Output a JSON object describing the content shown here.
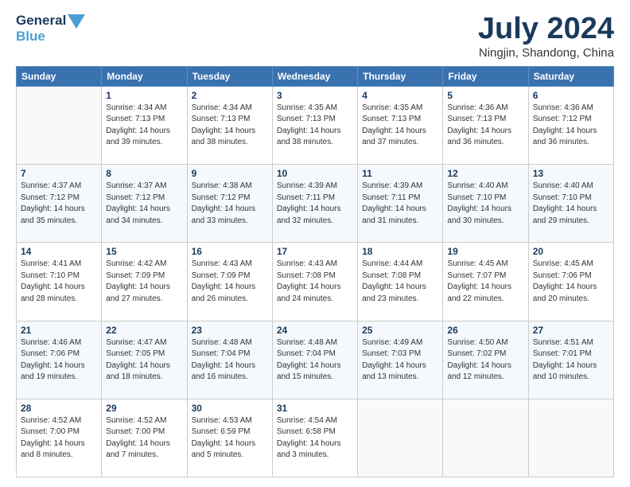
{
  "logo": {
    "line1": "General",
    "line2": "Blue"
  },
  "title": "July 2024",
  "subtitle": "Ningjin, Shandong, China",
  "days_of_week": [
    "Sunday",
    "Monday",
    "Tuesday",
    "Wednesday",
    "Thursday",
    "Friday",
    "Saturday"
  ],
  "weeks": [
    [
      {
        "day": "",
        "sunrise": "",
        "sunset": "",
        "daylight": ""
      },
      {
        "day": "1",
        "sunrise": "Sunrise: 4:34 AM",
        "sunset": "Sunset: 7:13 PM",
        "daylight": "Daylight: 14 hours and 39 minutes."
      },
      {
        "day": "2",
        "sunrise": "Sunrise: 4:34 AM",
        "sunset": "Sunset: 7:13 PM",
        "daylight": "Daylight: 14 hours and 38 minutes."
      },
      {
        "day": "3",
        "sunrise": "Sunrise: 4:35 AM",
        "sunset": "Sunset: 7:13 PM",
        "daylight": "Daylight: 14 hours and 38 minutes."
      },
      {
        "day": "4",
        "sunrise": "Sunrise: 4:35 AM",
        "sunset": "Sunset: 7:13 PM",
        "daylight": "Daylight: 14 hours and 37 minutes."
      },
      {
        "day": "5",
        "sunrise": "Sunrise: 4:36 AM",
        "sunset": "Sunset: 7:13 PM",
        "daylight": "Daylight: 14 hours and 36 minutes."
      },
      {
        "day": "6",
        "sunrise": "Sunrise: 4:36 AM",
        "sunset": "Sunset: 7:12 PM",
        "daylight": "Daylight: 14 hours and 36 minutes."
      }
    ],
    [
      {
        "day": "7",
        "sunrise": "Sunrise: 4:37 AM",
        "sunset": "Sunset: 7:12 PM",
        "daylight": "Daylight: 14 hours and 35 minutes."
      },
      {
        "day": "8",
        "sunrise": "Sunrise: 4:37 AM",
        "sunset": "Sunset: 7:12 PM",
        "daylight": "Daylight: 14 hours and 34 minutes."
      },
      {
        "day": "9",
        "sunrise": "Sunrise: 4:38 AM",
        "sunset": "Sunset: 7:12 PM",
        "daylight": "Daylight: 14 hours and 33 minutes."
      },
      {
        "day": "10",
        "sunrise": "Sunrise: 4:39 AM",
        "sunset": "Sunset: 7:11 PM",
        "daylight": "Daylight: 14 hours and 32 minutes."
      },
      {
        "day": "11",
        "sunrise": "Sunrise: 4:39 AM",
        "sunset": "Sunset: 7:11 PM",
        "daylight": "Daylight: 14 hours and 31 minutes."
      },
      {
        "day": "12",
        "sunrise": "Sunrise: 4:40 AM",
        "sunset": "Sunset: 7:10 PM",
        "daylight": "Daylight: 14 hours and 30 minutes."
      },
      {
        "day": "13",
        "sunrise": "Sunrise: 4:40 AM",
        "sunset": "Sunset: 7:10 PM",
        "daylight": "Daylight: 14 hours and 29 minutes."
      }
    ],
    [
      {
        "day": "14",
        "sunrise": "Sunrise: 4:41 AM",
        "sunset": "Sunset: 7:10 PM",
        "daylight": "Daylight: 14 hours and 28 minutes."
      },
      {
        "day": "15",
        "sunrise": "Sunrise: 4:42 AM",
        "sunset": "Sunset: 7:09 PM",
        "daylight": "Daylight: 14 hours and 27 minutes."
      },
      {
        "day": "16",
        "sunrise": "Sunrise: 4:43 AM",
        "sunset": "Sunset: 7:09 PM",
        "daylight": "Daylight: 14 hours and 26 minutes."
      },
      {
        "day": "17",
        "sunrise": "Sunrise: 4:43 AM",
        "sunset": "Sunset: 7:08 PM",
        "daylight": "Daylight: 14 hours and 24 minutes."
      },
      {
        "day": "18",
        "sunrise": "Sunrise: 4:44 AM",
        "sunset": "Sunset: 7:08 PM",
        "daylight": "Daylight: 14 hours and 23 minutes."
      },
      {
        "day": "19",
        "sunrise": "Sunrise: 4:45 AM",
        "sunset": "Sunset: 7:07 PM",
        "daylight": "Daylight: 14 hours and 22 minutes."
      },
      {
        "day": "20",
        "sunrise": "Sunrise: 4:45 AM",
        "sunset": "Sunset: 7:06 PM",
        "daylight": "Daylight: 14 hours and 20 minutes."
      }
    ],
    [
      {
        "day": "21",
        "sunrise": "Sunrise: 4:46 AM",
        "sunset": "Sunset: 7:06 PM",
        "daylight": "Daylight: 14 hours and 19 minutes."
      },
      {
        "day": "22",
        "sunrise": "Sunrise: 4:47 AM",
        "sunset": "Sunset: 7:05 PM",
        "daylight": "Daylight: 14 hours and 18 minutes."
      },
      {
        "day": "23",
        "sunrise": "Sunrise: 4:48 AM",
        "sunset": "Sunset: 7:04 PM",
        "daylight": "Daylight: 14 hours and 16 minutes."
      },
      {
        "day": "24",
        "sunrise": "Sunrise: 4:48 AM",
        "sunset": "Sunset: 7:04 PM",
        "daylight": "Daylight: 14 hours and 15 minutes."
      },
      {
        "day": "25",
        "sunrise": "Sunrise: 4:49 AM",
        "sunset": "Sunset: 7:03 PM",
        "daylight": "Daylight: 14 hours and 13 minutes."
      },
      {
        "day": "26",
        "sunrise": "Sunrise: 4:50 AM",
        "sunset": "Sunset: 7:02 PM",
        "daylight": "Daylight: 14 hours and 12 minutes."
      },
      {
        "day": "27",
        "sunrise": "Sunrise: 4:51 AM",
        "sunset": "Sunset: 7:01 PM",
        "daylight": "Daylight: 14 hours and 10 minutes."
      }
    ],
    [
      {
        "day": "28",
        "sunrise": "Sunrise: 4:52 AM",
        "sunset": "Sunset: 7:00 PM",
        "daylight": "Daylight: 14 hours and 8 minutes."
      },
      {
        "day": "29",
        "sunrise": "Sunrise: 4:52 AM",
        "sunset": "Sunset: 7:00 PM",
        "daylight": "Daylight: 14 hours and 7 minutes."
      },
      {
        "day": "30",
        "sunrise": "Sunrise: 4:53 AM",
        "sunset": "Sunset: 6:59 PM",
        "daylight": "Daylight: 14 hours and 5 minutes."
      },
      {
        "day": "31",
        "sunrise": "Sunrise: 4:54 AM",
        "sunset": "Sunset: 6:58 PM",
        "daylight": "Daylight: 14 hours and 3 minutes."
      },
      {
        "day": "",
        "sunrise": "",
        "sunset": "",
        "daylight": ""
      },
      {
        "day": "",
        "sunrise": "",
        "sunset": "",
        "daylight": ""
      },
      {
        "day": "",
        "sunrise": "",
        "sunset": "",
        "daylight": ""
      }
    ]
  ]
}
